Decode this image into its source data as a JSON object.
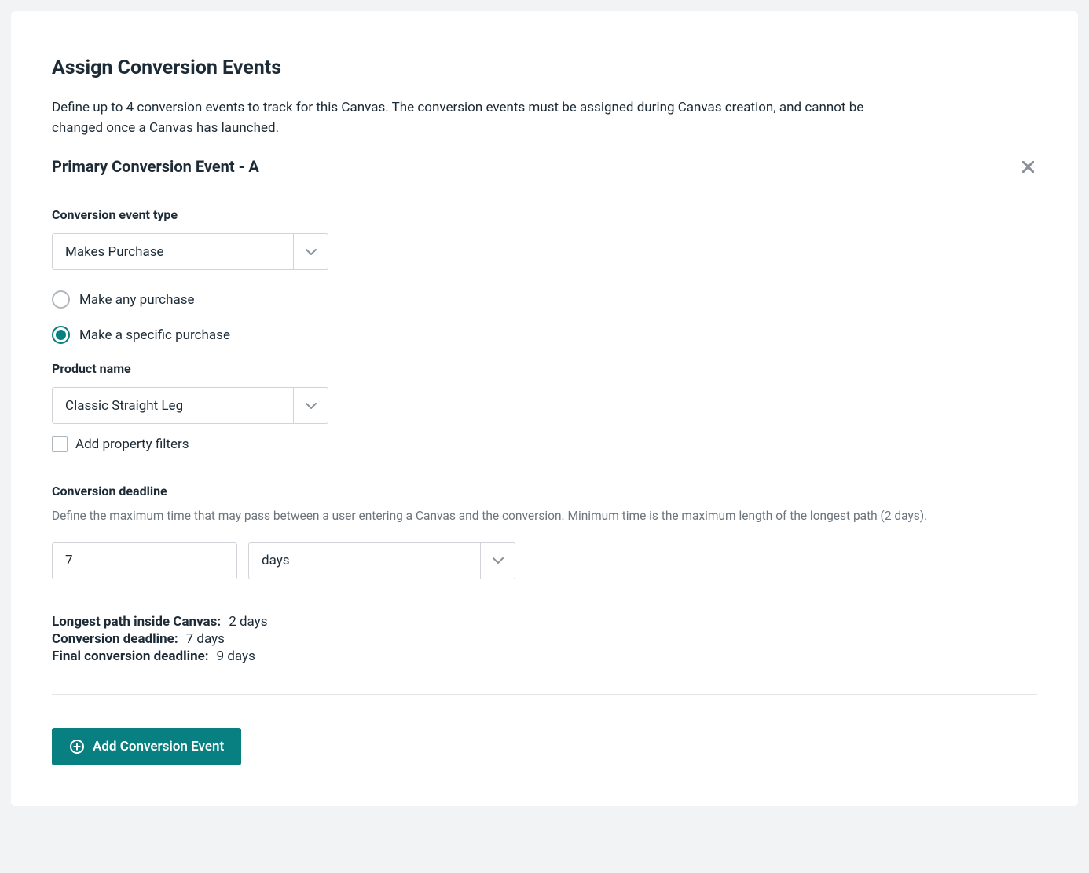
{
  "header": {
    "title": "Assign Conversion Events",
    "description": "Define up to 4 conversion events to track for this Canvas. The conversion events must be assigned during Canvas creation, and cannot be changed once a Canvas has launched."
  },
  "event": {
    "title": "Primary Conversion Event - A",
    "type_label": "Conversion event type",
    "type_value": "Makes Purchase",
    "radio_any": "Make any purchase",
    "radio_specific": "Make a specific purchase",
    "product_label": "Product name",
    "product_value": "Classic Straight Leg",
    "filter_label": "Add property filters"
  },
  "deadline": {
    "label": "Conversion deadline",
    "description": "Define the maximum time that may pass between a user entering a Canvas and the conversion. Minimum time is the maximum length of the longest path (2 days).",
    "value": "7",
    "unit": "days"
  },
  "summary": {
    "longest_label": "Longest path inside Canvas:",
    "longest_value": "2 days",
    "deadline_label": "Conversion deadline:",
    "deadline_value": "7 days",
    "final_label": "Final conversion deadline:",
    "final_value": "9 days"
  },
  "actions": {
    "add_button": "Add Conversion Event"
  }
}
